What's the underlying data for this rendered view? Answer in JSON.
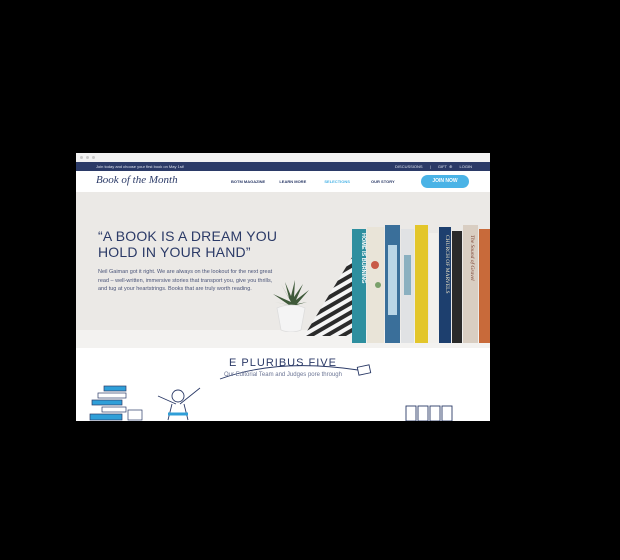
{
  "topbar": {
    "promo": "Join today and choose your first book on May 1st!",
    "links": [
      "DISCUSSIONS",
      "GIFT",
      "LOGIN"
    ]
  },
  "nav": {
    "logo": "Book of the Month",
    "links": [
      "BOTM MAGAZINE",
      "LEARN MORE",
      "SELECTIONS",
      "OUR STORY"
    ],
    "join": "JOIN NOW"
  },
  "hero": {
    "headline_line1": "“A BOOK IS A DREAM YOU",
    "headline_line2": "HOLD IN YOUR HAND”",
    "body": "Neil Gaiman got it right. We are always on the lookout for the next great read – well-written, immersive stories that transport you, give you thrills, and tug at your heartstrings. Books that are truly worth reading.",
    "book_titles": [
      "HOME IS BURNING",
      "CHURCH OF MARVELS",
      "The Sound of Gravel"
    ]
  },
  "section": {
    "title": "E PLURIBUS FIVE",
    "subtitle": "Our Editorial Team and Judges pore through"
  },
  "colors": {
    "navy": "#2b3a67",
    "accent": "#4ab3e6",
    "hero_bg": "#ebe9e6"
  }
}
